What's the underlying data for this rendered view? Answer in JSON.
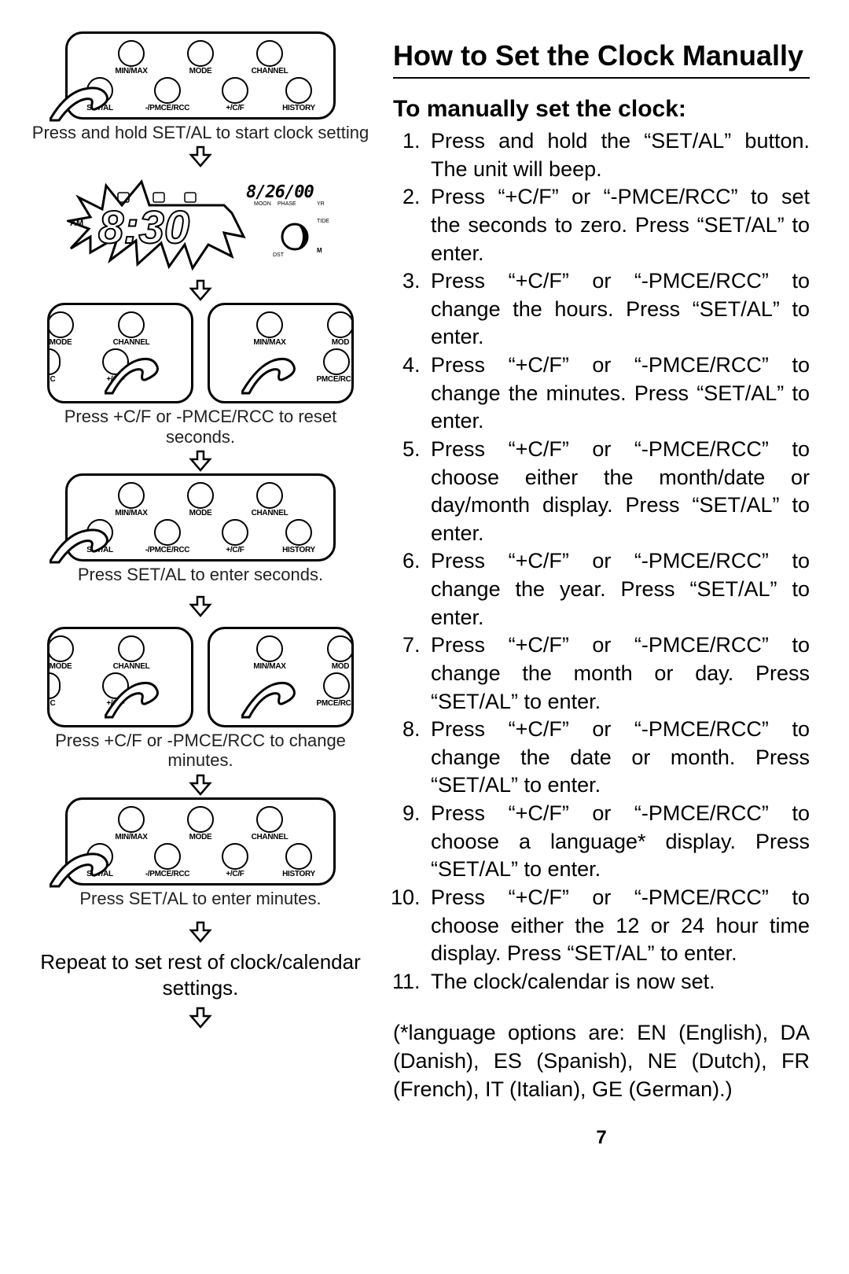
{
  "page_number": "7",
  "heading": "How to Set the Clock Manually",
  "subheading": "To manually set the clock:",
  "steps": [
    "Press and hold the “SET/AL” button. The unit will beep.",
    "Press “+C/F” or “-PMCE/RCC” to set the seconds to zero. Press “SET/AL” to enter.",
    "Press “+C/F” or “-PMCE/RCC” to change the hours. Press “SET/AL” to enter.",
    "Press “+C/F” or “-PMCE/RCC” to change the minutes. Press “SET/AL” to enter.",
    "Press “+C/F” or “-PMCE/RCC” to choose either the month/date or day/month display. Press “SET/AL” to enter.",
    "Press “+C/F” or “-PMCE/RCC” to change the year. Press “SET/AL” to enter.",
    "Press “+C/F” or “-PMCE/RCC” to change the month or day. Press “SET/AL” to enter.",
    "Press “+C/F” or “-PMCE/RCC” to change the date or month. Press “SET/AL” to enter.",
    "Press “+C/F” or “-PMCE/RCC” to choose a language* display. Press “SET/AL” to enter.",
    "Press “+C/F” or “-PMCE/RCC” to choose either the 12 or 24 hour time display. Press “SET/AL” to enter.",
    "The clock/calendar is now set."
  ],
  "lang_note": "(*language options are: EN (English), DA (Danish), ES (Spanish), NE (Dutch), FR (French), IT (Italian), GE (German).)",
  "buttons": {
    "min_max": "MIN/MAX",
    "mode": "MODE",
    "channel": "CHANNEL",
    "set_al": "SET/AL",
    "minus_pmce": "-/PMCE/RCC",
    "pmce": "PMCE/RCC",
    "plus_cf": "+/C/F",
    "history": "HISTORY"
  },
  "lcd": {
    "am": "AM",
    "time": "8:30",
    "date": "8/26/00",
    "labels": {
      "moon": "MOON",
      "phase": "PHASE",
      "yr": "YR",
      "tide": "TIDE",
      "dst": "DST",
      "m": "M"
    }
  },
  "captions": {
    "c1": "Press and hold SET/AL to start clock setting",
    "c2": "Press +C/F or -PMCE/RCC to reset seconds.",
    "c3": "Press SET/AL to enter seconds.",
    "c4": "Press +C/F or -PMCE/RCC to change minutes.",
    "c5": "Press SET/AL to enter minutes.",
    "c6": "Repeat to set rest of clock/calendar settings."
  }
}
